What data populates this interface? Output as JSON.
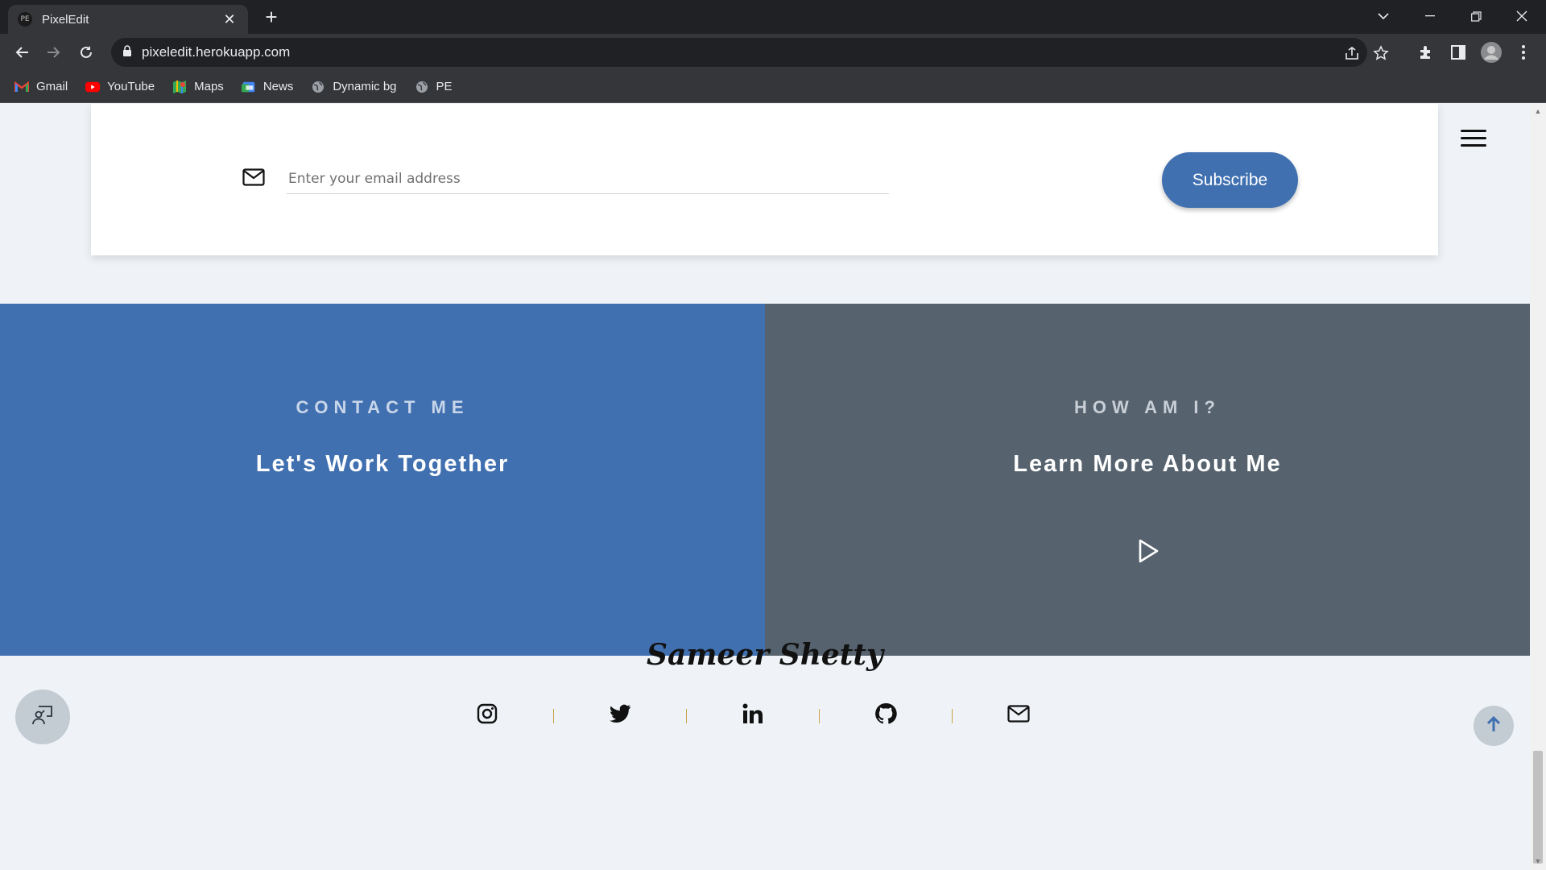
{
  "browser": {
    "tab_title": "PixelEdit",
    "tab_favicon_text": "PE",
    "url": "pixeledit.herokuapp.com",
    "bookmarks": [
      {
        "label": "Gmail",
        "icon": "gmail-icon"
      },
      {
        "label": "YouTube",
        "icon": "youtube-icon"
      },
      {
        "label": "Maps",
        "icon": "maps-icon"
      },
      {
        "label": "News",
        "icon": "news-icon"
      },
      {
        "label": "Dynamic bg",
        "icon": "globe-icon"
      },
      {
        "label": "PE",
        "icon": "globe-icon"
      }
    ]
  },
  "newsletter": {
    "email_placeholder": "Enter your email address",
    "email_value": "",
    "subscribe_label": "Subscribe"
  },
  "contact": {
    "eyebrow": "CONTACT ME",
    "title": "Let's Work Together"
  },
  "about": {
    "eyebrow": "HOW AM I?",
    "title": "Learn More About Me"
  },
  "footer": {
    "name": "Sameer Shetty",
    "socials": [
      "instagram-icon",
      "twitter-icon",
      "linkedin-icon",
      "github-icon",
      "mail-icon"
    ]
  },
  "colors": {
    "contact_bg": "#4170b0",
    "about_bg": "#56636f",
    "subscribe_bg": "#4070b0",
    "page_bg": "#eff3f7"
  }
}
